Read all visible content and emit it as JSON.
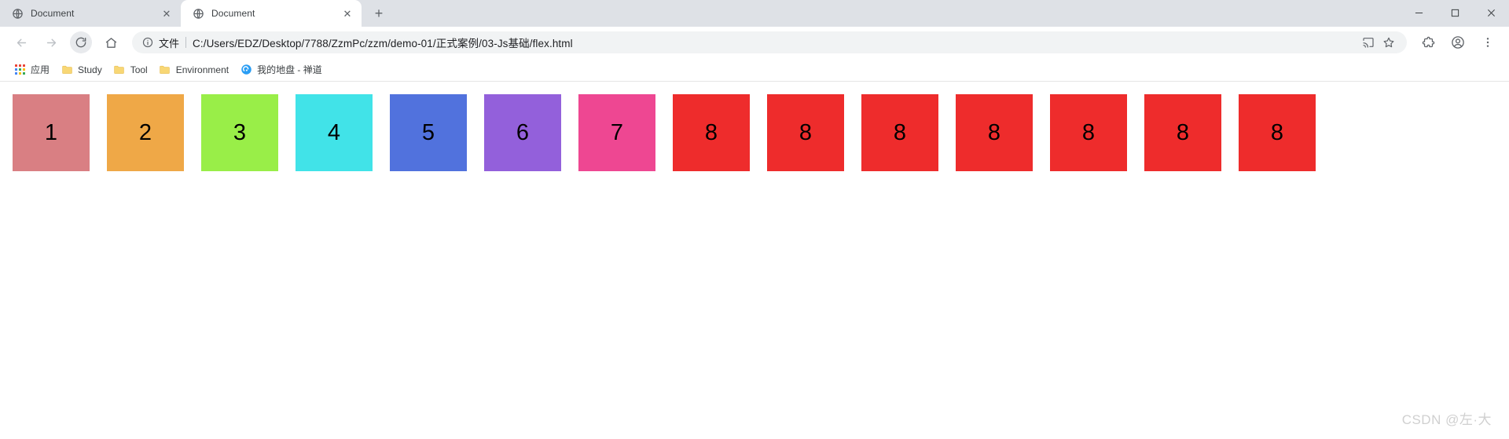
{
  "window": {
    "minimize_label": "—",
    "maximize_label": "☐",
    "close_label": "✕"
  },
  "tabs": [
    {
      "title": "Document",
      "favicon": "globe-icon",
      "close_label": "✕",
      "active": false
    },
    {
      "title": "Document",
      "favicon": "globe-icon",
      "close_label": "✕",
      "active": true
    }
  ],
  "new_tab_label": "+",
  "toolbar": {
    "back_label": "←",
    "forward_label": "→",
    "reload_label": "⟳",
    "home_label": "⌂",
    "cast_label": "cast-icon",
    "bookmark_star_label": "☆",
    "extensions_label": "puzzle-icon",
    "profile_label": "avatar-icon",
    "menu_label": "⋮"
  },
  "omnibox": {
    "info_icon": "info-circle-icon",
    "scheme_label": "文件",
    "url": "C:/Users/EDZ/Desktop/7788/ZzmPc/zzm/demo-01/正式案例/03-Js基础/flex.html"
  },
  "bookmarks": [
    {
      "label": "应用",
      "icon": "apps-grid-icon"
    },
    {
      "label": "Study",
      "icon": "folder-icon"
    },
    {
      "label": "Tool",
      "icon": "folder-icon"
    },
    {
      "label": "Environment",
      "icon": "folder-icon"
    },
    {
      "label": "我的地盘 - 禅道",
      "icon": "zentao-icon"
    }
  ],
  "page": {
    "boxes": [
      {
        "label": "1",
        "color": "#d97f83"
      },
      {
        "label": "2",
        "color": "#efa847"
      },
      {
        "label": "3",
        "color": "#99ee48"
      },
      {
        "label": "4",
        "color": "#41e3e8"
      },
      {
        "label": "5",
        "color": "#5172dd"
      },
      {
        "label": "6",
        "color": "#9360db"
      },
      {
        "label": "7",
        "color": "#ee4792"
      },
      {
        "label": "8",
        "color": "#ee2c2c"
      },
      {
        "label": "8",
        "color": "#ee2c2c"
      },
      {
        "label": "8",
        "color": "#ee2c2c"
      },
      {
        "label": "8",
        "color": "#ee2c2c"
      },
      {
        "label": "8",
        "color": "#ee2c2c"
      },
      {
        "label": "8",
        "color": "#ee2c2c"
      },
      {
        "label": "8",
        "color": "#ee2c2c"
      }
    ],
    "watermark": "CSDN @左·大"
  },
  "colors": {
    "tabstrip_bg": "#dee1e6",
    "toolbar_bg": "#ffffff",
    "omnibox_bg": "#f1f3f4",
    "text": "#202124"
  }
}
